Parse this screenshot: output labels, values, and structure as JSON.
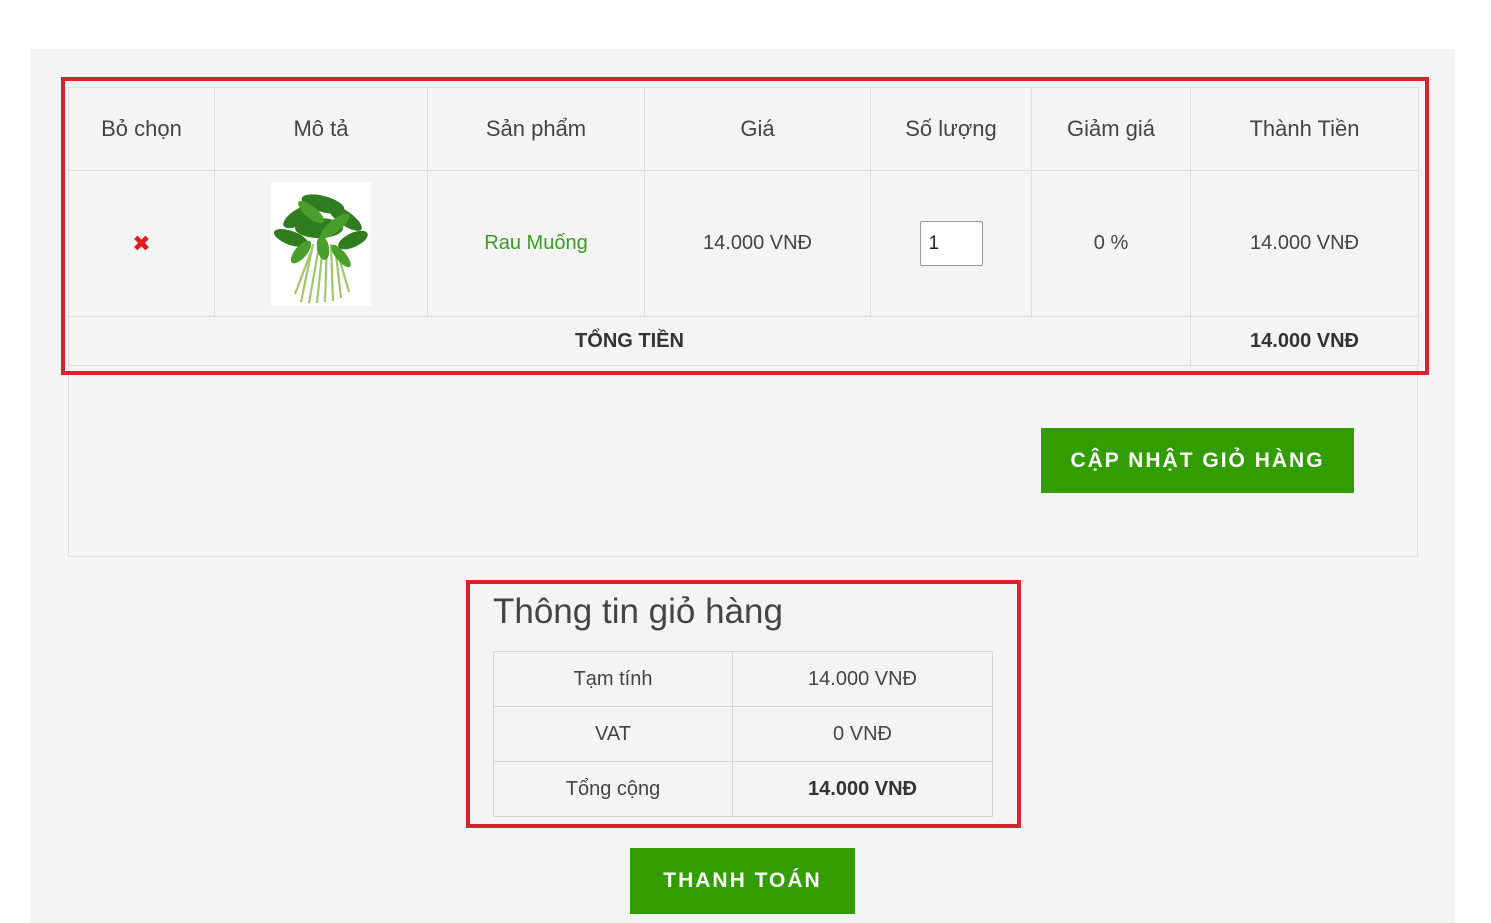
{
  "cart": {
    "headers": [
      "Bỏ chọn",
      "Mô tả",
      "Sản phẩm",
      "Giá",
      "Số lượng",
      "Giảm giá",
      "Thành Tiền"
    ],
    "items": [
      {
        "remove_icon": "✖",
        "image": "water-spinach-bunch",
        "name": "Rau Muống",
        "price": "14.000 VNĐ",
        "quantity": "1",
        "discount": "0 %",
        "subtotal": "14.000 VNĐ"
      }
    ],
    "total_label": "TỔNG TIỀN",
    "total_value": "14.000 VNĐ",
    "update_button": "CẬP NHẬT GIỎ HÀNG"
  },
  "summary": {
    "title": "Thông tin giỏ hàng",
    "rows": [
      {
        "label": "Tạm tính",
        "value": "14.000 VNĐ"
      },
      {
        "label": "VAT",
        "value": "0 VNĐ"
      },
      {
        "label": "Tổng cộng",
        "value": "14.000 VNĐ"
      }
    ],
    "checkout_button": "THANH TOÁN"
  },
  "colors": {
    "accent_green": "#339d00",
    "link_green": "#3b9b1f",
    "remove_red": "#e01b22",
    "highlight_red": "#d9232d",
    "panel_bg": "#f4f4f4"
  }
}
